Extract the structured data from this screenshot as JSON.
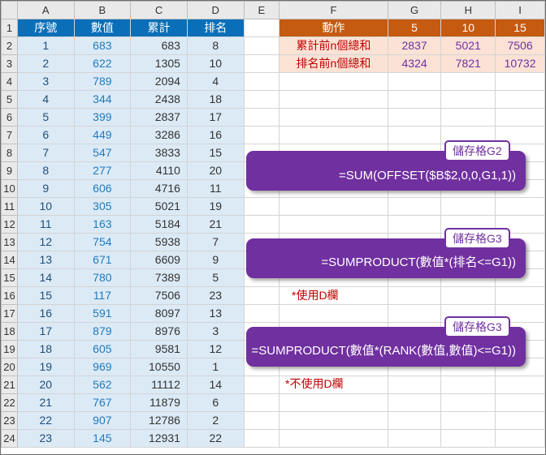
{
  "columns": [
    "A",
    "B",
    "C",
    "D",
    "E",
    "F",
    "G",
    "H",
    "I"
  ],
  "rows": [
    "1",
    "2",
    "3",
    "4",
    "5",
    "6",
    "7",
    "8",
    "9",
    "10",
    "11",
    "12",
    "13",
    "14",
    "15",
    "16",
    "17",
    "18",
    "19",
    "20",
    "21",
    "22",
    "23",
    "24"
  ],
  "table": {
    "headers": [
      "序號",
      "數值",
      "累計",
      "排名"
    ],
    "rows": [
      [
        "1",
        "683",
        "683",
        "8"
      ],
      [
        "2",
        "622",
        "1305",
        "10"
      ],
      [
        "3",
        "789",
        "2094",
        "4"
      ],
      [
        "4",
        "344",
        "2438",
        "18"
      ],
      [
        "5",
        "399",
        "2837",
        "17"
      ],
      [
        "6",
        "449",
        "3286",
        "16"
      ],
      [
        "7",
        "547",
        "3833",
        "15"
      ],
      [
        "8",
        "277",
        "4110",
        "20"
      ],
      [
        "9",
        "606",
        "4716",
        "11"
      ],
      [
        "10",
        "305",
        "5021",
        "19"
      ],
      [
        "11",
        "163",
        "5184",
        "21"
      ],
      [
        "12",
        "754",
        "5938",
        "7"
      ],
      [
        "13",
        "671",
        "6609",
        "9"
      ],
      [
        "14",
        "780",
        "7389",
        "5"
      ],
      [
        "15",
        "117",
        "7506",
        "23"
      ],
      [
        "16",
        "591",
        "8097",
        "13"
      ],
      [
        "17",
        "879",
        "8976",
        "3"
      ],
      [
        "18",
        "605",
        "9581",
        "12"
      ],
      [
        "19",
        "969",
        "10550",
        "1"
      ],
      [
        "20",
        "562",
        "11112",
        "14"
      ],
      [
        "21",
        "767",
        "11879",
        "6"
      ],
      [
        "22",
        "907",
        "12786",
        "2"
      ],
      [
        "23",
        "145",
        "12931",
        "22"
      ]
    ]
  },
  "summary": {
    "header": [
      "動作",
      "5",
      "10",
      "15"
    ],
    "rows": [
      [
        "累計前n個總和",
        "2837",
        "5021",
        "7506"
      ],
      [
        "排名前n個總和",
        "4324",
        "7821",
        "10732"
      ]
    ]
  },
  "callouts": [
    {
      "tag": "儲存格G2",
      "formula": "=SUM(OFFSET($B$2,0,0,G1,1))"
    },
    {
      "tag": "儲存格G3",
      "formula": "=SUMPRODUCT(數值*(排名<=G1))"
    },
    {
      "tag": "儲存格G3",
      "formula": "=SUMPRODUCT(數值*(RANK(數值,數值)<=G1))"
    }
  ],
  "notes": [
    "*使用D欄",
    "*不使用D欄"
  ],
  "colors": {
    "table_header": "#0a6fb8",
    "table_fill": "#dceaf6",
    "summary_header": "#c55a11",
    "summary_fill": "#fbe2d5",
    "callout": "#7030a0",
    "note": "#c00000"
  }
}
